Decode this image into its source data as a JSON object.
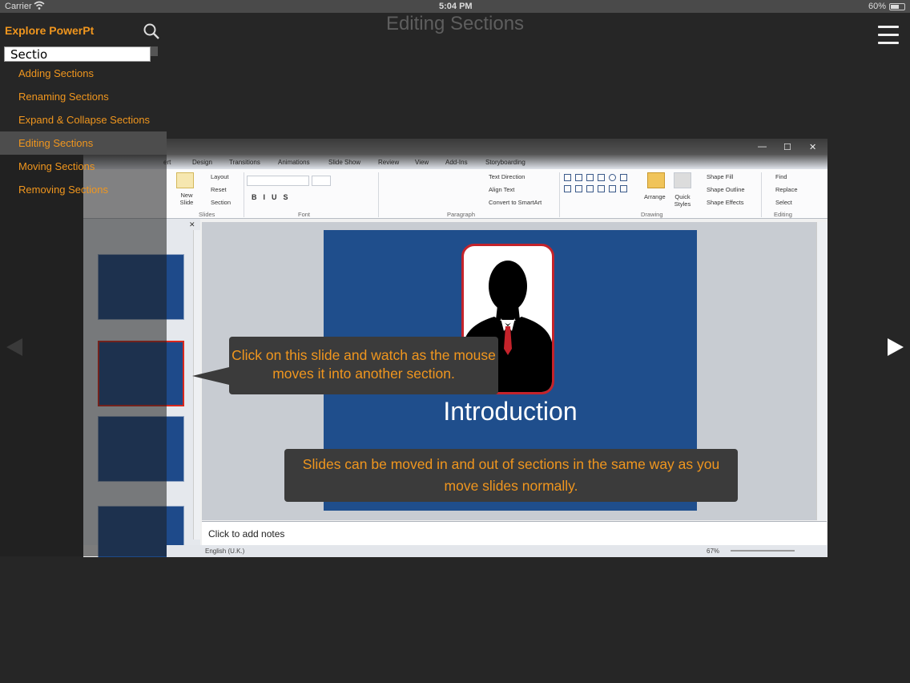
{
  "status_bar": {
    "carrier": "Carrier",
    "time": "5:04 PM",
    "battery": "60%"
  },
  "page": {
    "title": "Editing Sections"
  },
  "sidebar": {
    "header": "Explore PowerPt",
    "search_value": "Sectio",
    "items": [
      {
        "label": "Adding Sections"
      },
      {
        "label": "Renaming Sections"
      },
      {
        "label": "Expand & Collapse Sections"
      },
      {
        "label": "Editing Sections",
        "active": true
      },
      {
        "label": "Moving Sections"
      },
      {
        "label": "Removing Sections"
      }
    ]
  },
  "ppt": {
    "tabs": [
      "ert",
      "Design",
      "Transitions",
      "Animations",
      "Slide Show",
      "Review",
      "View",
      "Add-Ins",
      "Storyboarding"
    ],
    "ribbon": {
      "new_slide": "New Slide",
      "layout": "Layout",
      "reset": "Reset",
      "section": "Section",
      "slides_group": "Slides",
      "font_group": "Font",
      "paragraph_group": "Paragraph",
      "text_direction": "Text Direction",
      "align_text": "Align Text",
      "convert_smartart": "Convert to SmartArt",
      "drawing_group": "Drawing",
      "arrange": "Arrange",
      "quick_styles": "Quick Styles",
      "shape_fill": "Shape Fill",
      "shape_outline": "Shape Outline",
      "shape_effects": "Shape Effects",
      "find": "Find",
      "replace": "Replace",
      "select": "Select",
      "editing_group": "Editing"
    },
    "slide_title": "Introduction",
    "notes_placeholder": "Click to add notes",
    "status_language": "English (U.K.)",
    "zoom": "67%"
  },
  "callouts": {
    "first": "Click on this slide and watch as the mouse moves it into another section.",
    "second": "Slides can be moved in and out of sections in the same way as you move slides normally."
  },
  "colors": {
    "accent": "#f0961e",
    "slide_bg": "#1f4e8c",
    "callout_bg": "#3b3b3b"
  }
}
